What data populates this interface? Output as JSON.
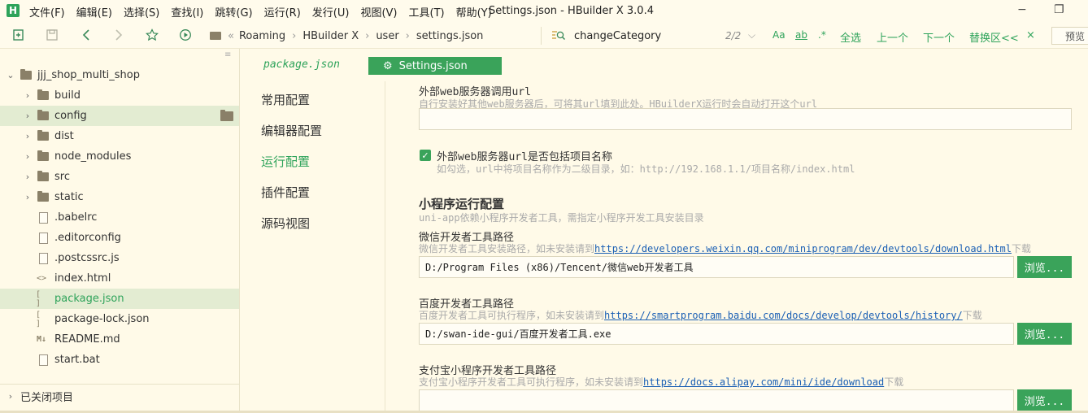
{
  "app": {
    "logo_letter": "H",
    "window_title": "Settings.json - HBuilder X 3.0.4",
    "menu": [
      "文件(F)",
      "编辑(E)",
      "选择(S)",
      "查找(I)",
      "跳转(G)",
      "运行(R)",
      "发行(U)",
      "视图(V)",
      "工具(T)",
      "帮助(Y)"
    ],
    "minimize_glyph": "−",
    "restore_glyph": "❐"
  },
  "toolbar": {
    "breadcrumb": [
      "Roaming",
      "HBuilder X",
      "user",
      "settings.json"
    ],
    "breadcrumb_prefix": "«",
    "search": {
      "value": "changeCategory",
      "match_count": "2/2",
      "opt_case": "Aa",
      "opt_word": "ab",
      "opt_regex": ".*",
      "select_all": "全选",
      "prev": "上一个",
      "next": "下一个",
      "replace": "替换区<<",
      "close": "×"
    },
    "preview_label": "预览"
  },
  "sidebar": {
    "project_name": "jjj_shop_multi_shop",
    "items": [
      {
        "label": "build",
        "type": "folder"
      },
      {
        "label": "config",
        "type": "folder"
      },
      {
        "label": "dist",
        "type": "folder"
      },
      {
        "label": "node_modules",
        "type": "folder"
      },
      {
        "label": "src",
        "type": "folder"
      },
      {
        "label": "static",
        "type": "folder"
      },
      {
        "label": ".babelrc",
        "type": "file"
      },
      {
        "label": ".editorconfig",
        "type": "file"
      },
      {
        "label": ".postcssrc.js",
        "type": "js"
      },
      {
        "label": "index.html",
        "type": "html"
      },
      {
        "label": "package.json",
        "type": "json"
      },
      {
        "label": "package-lock.json",
        "type": "json"
      },
      {
        "label": "README.md",
        "type": "md"
      },
      {
        "label": "start.bat",
        "type": "file"
      }
    ],
    "closed_projects": "已关闭项目"
  },
  "tabs": {
    "package": "package.json",
    "settings": "Settings.json"
  },
  "settings_nav": [
    "常用配置",
    "编辑器配置",
    "运行配置",
    "插件配置",
    "源码视图"
  ],
  "settings": {
    "ext_server": {
      "label": "外部web服务器调用url",
      "desc": "自行安装好其他web服务器后，可将其url填到此处。HBuilderX运行时会自动打开这个url",
      "value": ""
    },
    "ext_include": {
      "label": "外部web服务器url是否包括项目名称",
      "desc": "如勾选，url中将项目名称作为二级目录，如：http://192.168.1.1/项目名称/index.html"
    },
    "mini_section": {
      "title": "小程序运行配置",
      "desc": "uni-app依赖小程序开发者工具，需指定小程序开发工具安装目录"
    },
    "wechat": {
      "label": "微信开发者工具路径",
      "desc_prefix": "微信开发者工具安装路径，如未安装请到",
      "link": "https://developers.weixin.qq.com/miniprogram/dev/devtools/download.html",
      "desc_suffix": "下载",
      "value": "D:/Program Files (x86)/Tencent/微信web开发者工具"
    },
    "baidu": {
      "label": "百度开发者工具路径",
      "desc_prefix": "百度开发者工具可执行程序，如未安装请到",
      "link": "https://smartprogram.baidu.com/docs/develop/devtools/history/",
      "desc_suffix": "下载",
      "value": "D:/swan-ide-gui/百度开发者工具.exe"
    },
    "alipay": {
      "label": "支付宝小程序开发者工具路径",
      "desc_prefix": "支付宝小程序开发者工具可执行程序，如未安装请到",
      "link": "https://docs.alipay.com/mini/ide/download",
      "desc_suffix": "下载",
      "value": ""
    },
    "browse_label": "浏览..."
  }
}
